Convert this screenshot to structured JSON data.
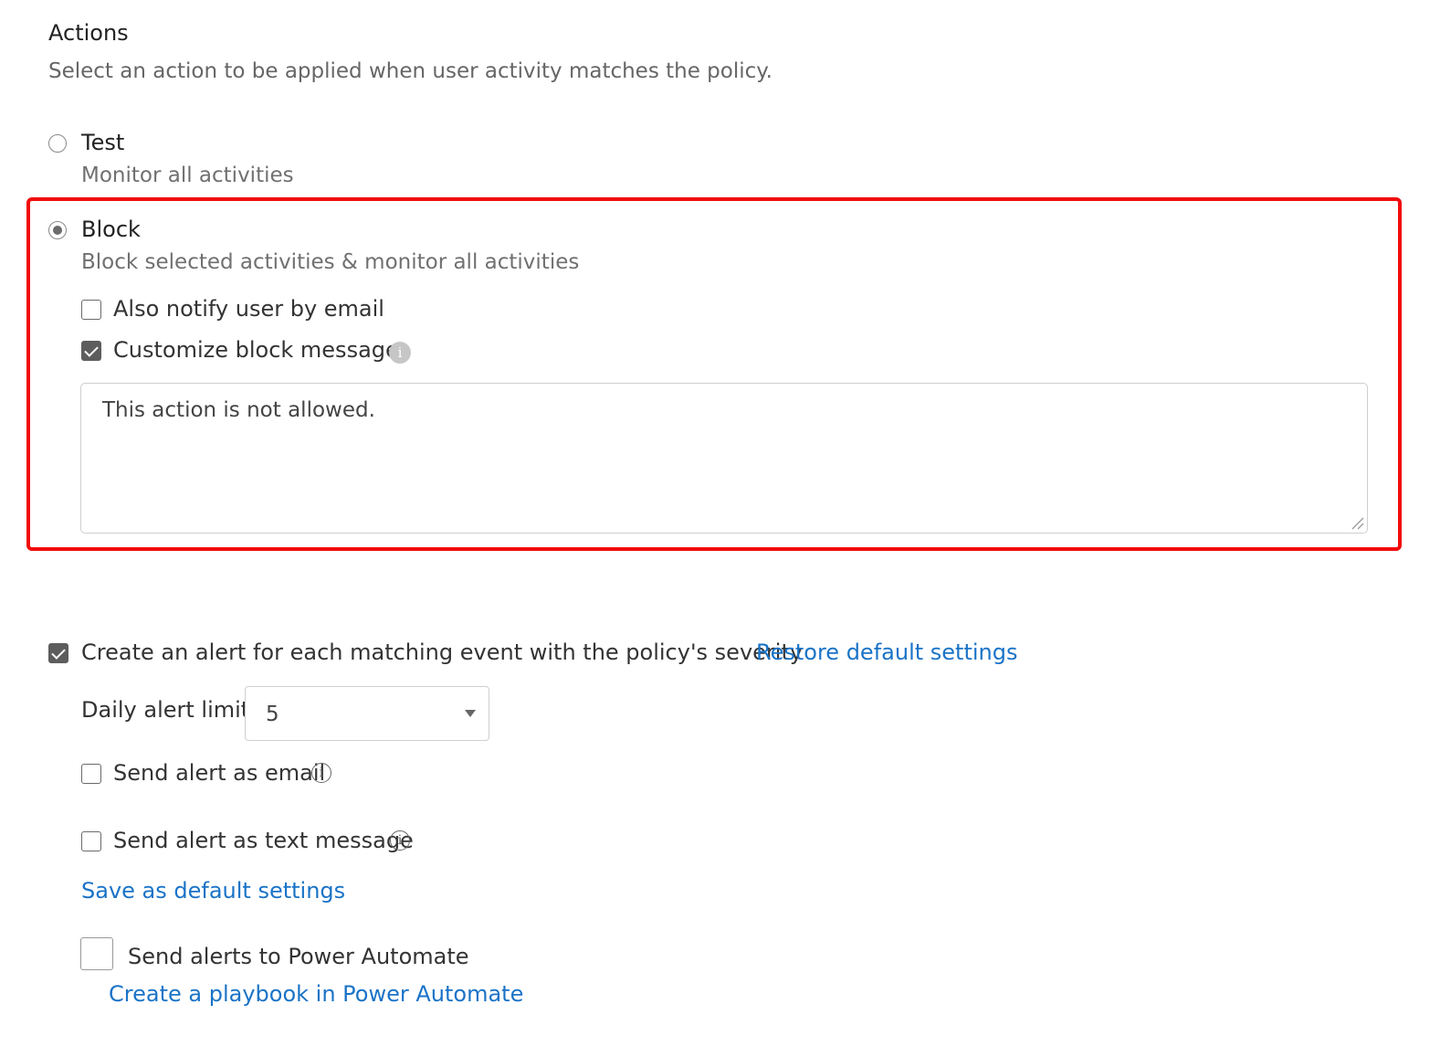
{
  "section": {
    "title": "Actions",
    "subtitle": "Select an action to be applied when user activity matches the policy."
  },
  "options": [
    {
      "label": "Test",
      "description": "Monitor all activities",
      "selected": false
    },
    {
      "label": "Block",
      "description": "Block selected activities & monitor all activities",
      "selected": true
    }
  ],
  "block": {
    "notify_email_label": "Also notify user by email",
    "notify_email_checked": false,
    "customize_label": "Customize block message",
    "customize_checked": true,
    "info_icon": "info-icon",
    "message_value": "This action is not allowed."
  },
  "alerts": {
    "create_alert_label": "Create an alert for each matching event with the policy's severity",
    "create_alert_checked": true,
    "restore_link": "Restore default settings",
    "daily_limit_label": "Daily alert limit",
    "daily_limit_value": "5",
    "send_email_label": "Send alert as email",
    "send_email_checked": false,
    "send_text_label": "Send alert as text message",
    "send_text_checked": false,
    "save_default_link": "Save as default settings",
    "power_automate_label": "Send alerts to Power Automate",
    "power_automate_checked": false,
    "playbook_link": "Create a playbook in Power Automate"
  },
  "colors": {
    "highlight_border": "#f20a0a",
    "link": "#1a73c7"
  }
}
